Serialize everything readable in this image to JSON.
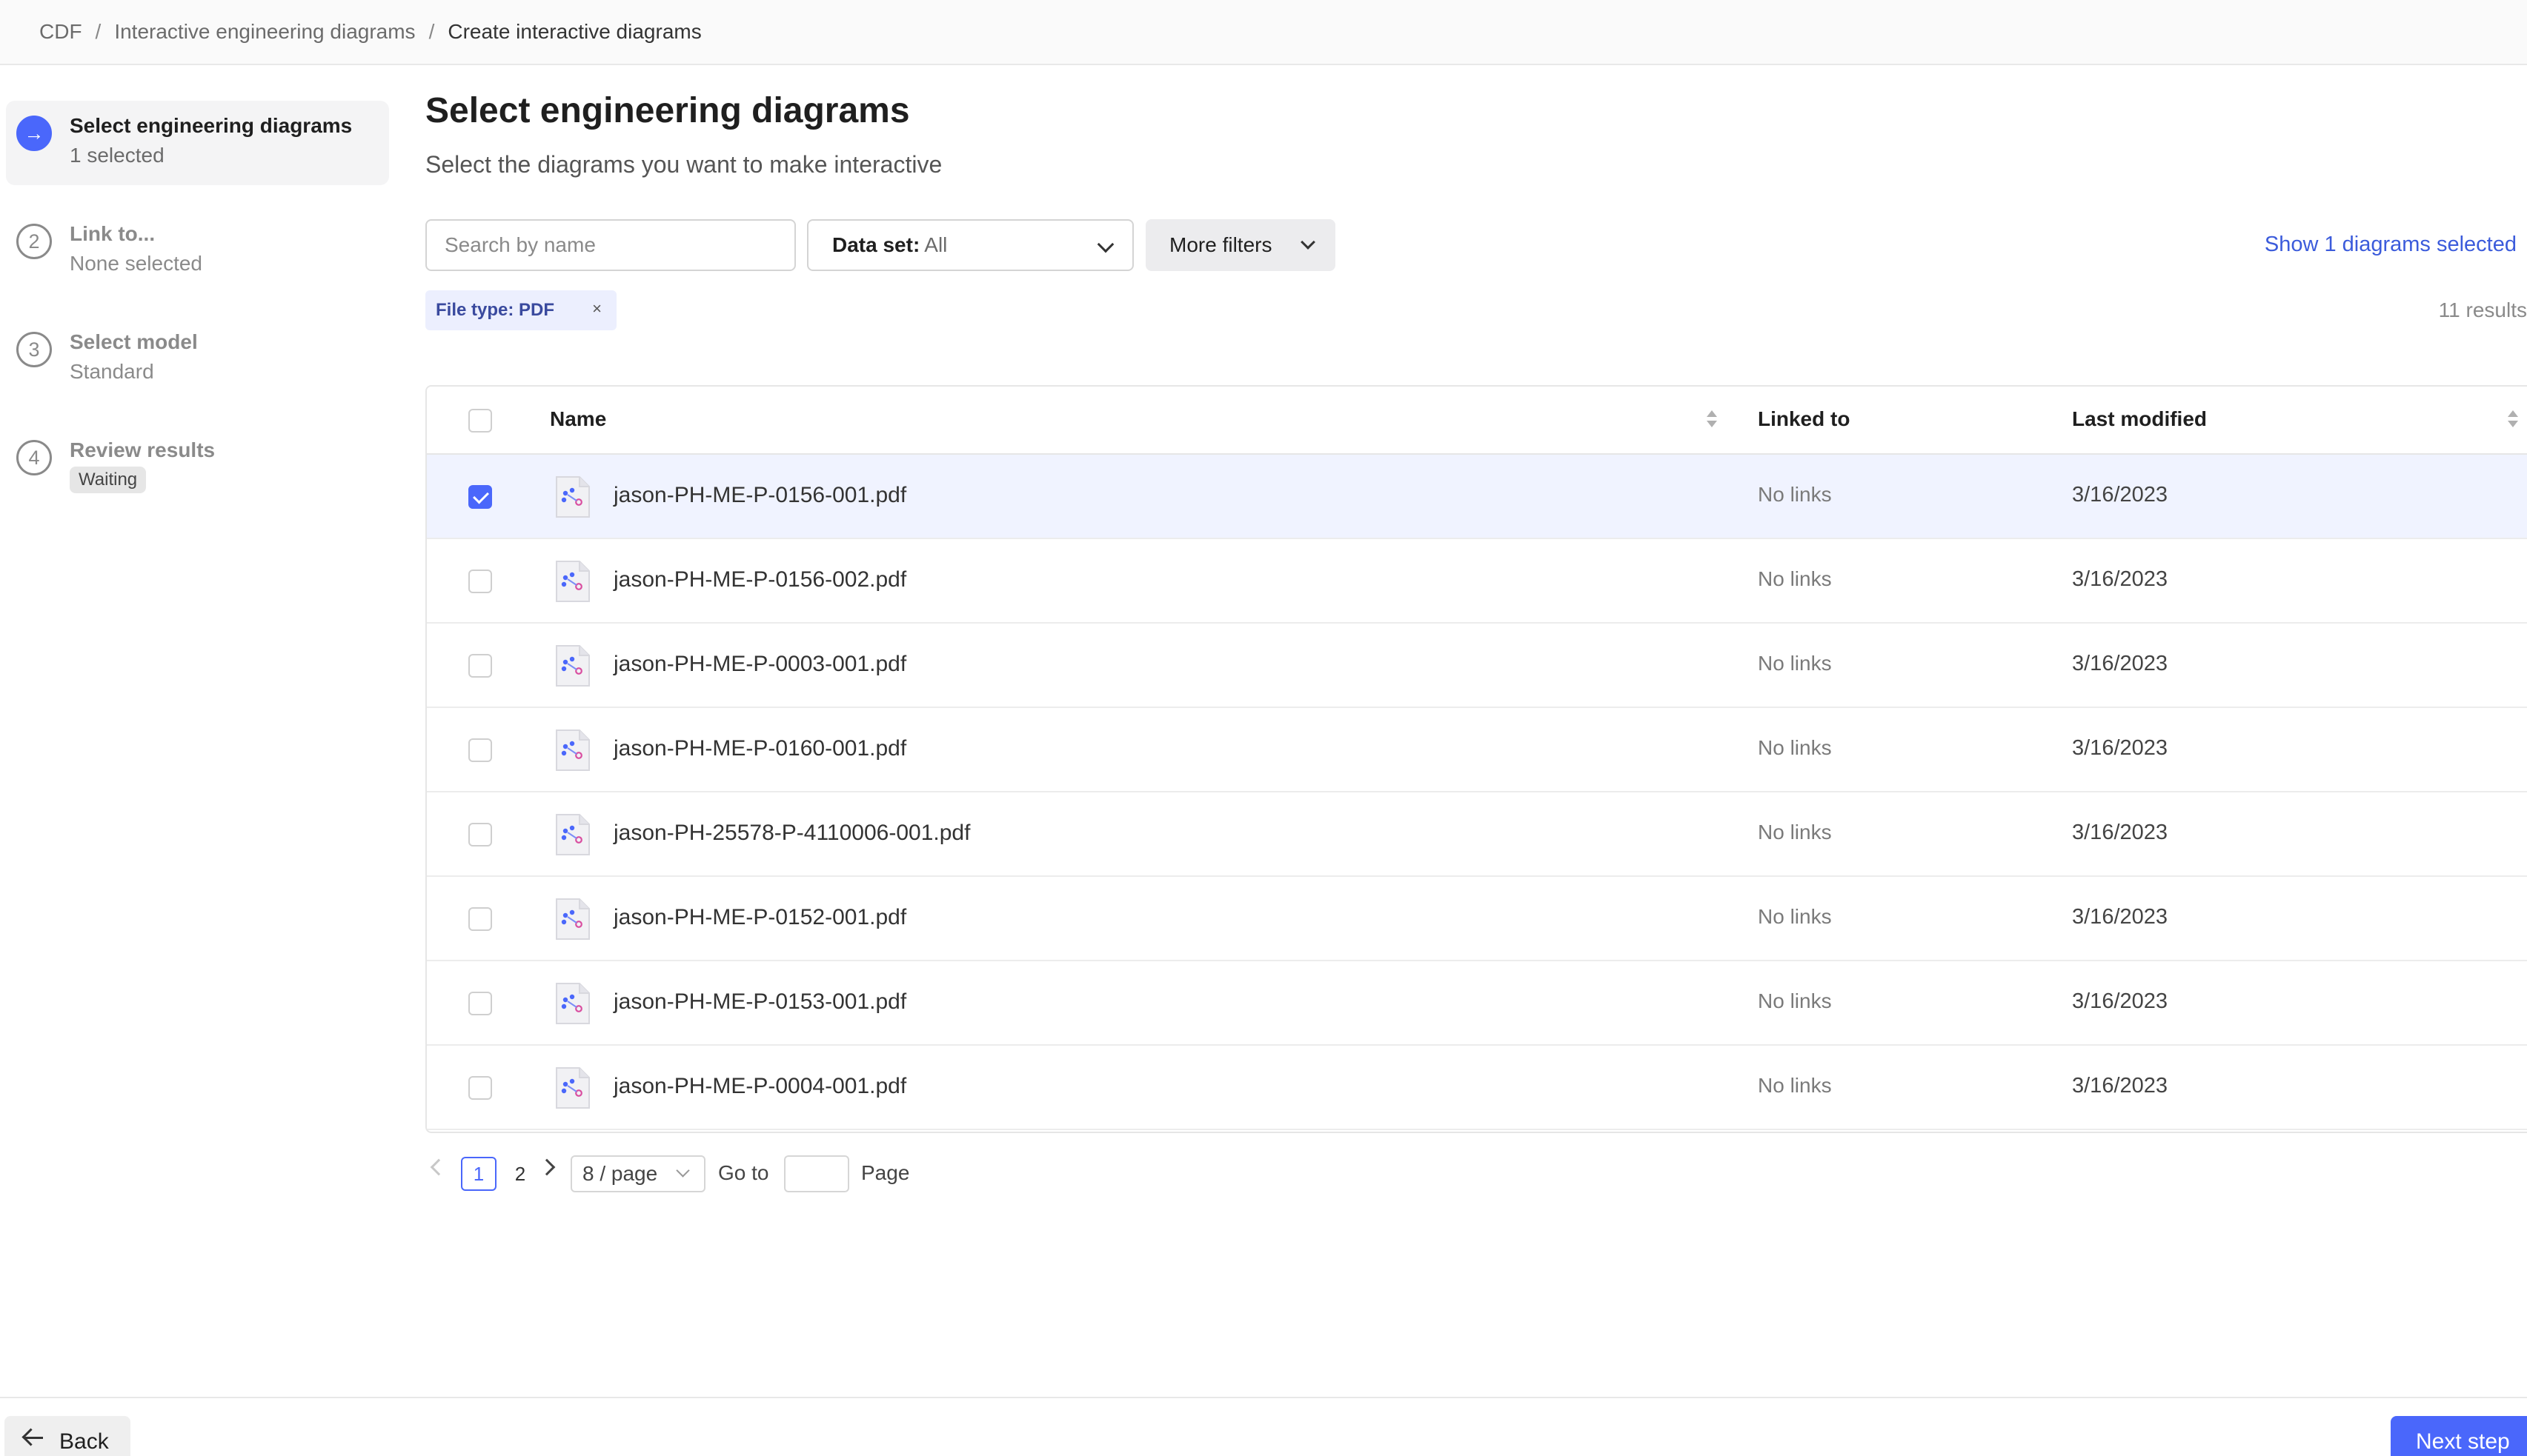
{
  "breadcrumb": {
    "items": [
      "CDF",
      "Interactive engineering diagrams",
      "Create interactive diagrams"
    ],
    "separator": "/"
  },
  "stepper": {
    "steps": [
      {
        "number": "→",
        "title": "Select engineering diagrams",
        "subtitle": "1 selected",
        "active": true
      },
      {
        "number": "2",
        "title": "Link to...",
        "subtitle": "None selected",
        "active": false
      },
      {
        "number": "3",
        "title": "Select model",
        "subtitle": "Standard",
        "active": false
      },
      {
        "number": "4",
        "title": "Review results",
        "badge": "Waiting",
        "active": false
      }
    ]
  },
  "main": {
    "title": "Select engineering diagrams",
    "subtitle": "Select the diagrams you want to make interactive"
  },
  "filters": {
    "search_placeholder": "Search by name",
    "dataset_label": "Data set:",
    "dataset_value": "All",
    "more_filters_label": "More filters",
    "show_selected_label": "Show 1 diagrams selected",
    "chip_label": "File type: PDF",
    "chip_remove": "×",
    "results_count": "11 results"
  },
  "table": {
    "headers": {
      "name": "Name",
      "linked_to": "Linked to",
      "last_modified": "Last modified"
    },
    "rows": [
      {
        "name": "jason-PH-ME-P-0156-001.pdf",
        "linked_to": "No links",
        "last_modified": "3/16/2023",
        "selected": true
      },
      {
        "name": "jason-PH-ME-P-0156-002.pdf",
        "linked_to": "No links",
        "last_modified": "3/16/2023",
        "selected": false
      },
      {
        "name": "jason-PH-ME-P-0003-001.pdf",
        "linked_to": "No links",
        "last_modified": "3/16/2023",
        "selected": false
      },
      {
        "name": "jason-PH-ME-P-0160-001.pdf",
        "linked_to": "No links",
        "last_modified": "3/16/2023",
        "selected": false
      },
      {
        "name": "jason-PH-25578-P-4110006-001.pdf",
        "linked_to": "No links",
        "last_modified": "3/16/2023",
        "selected": false
      },
      {
        "name": "jason-PH-ME-P-0152-001.pdf",
        "linked_to": "No links",
        "last_modified": "3/16/2023",
        "selected": false
      },
      {
        "name": "jason-PH-ME-P-0153-001.pdf",
        "linked_to": "No links",
        "last_modified": "3/16/2023",
        "selected": false
      },
      {
        "name": "jason-PH-ME-P-0004-001.pdf",
        "linked_to": "No links",
        "last_modified": "3/16/2023",
        "selected": false
      }
    ],
    "file_icon": "diagram-file-icon"
  },
  "pagination": {
    "pages": [
      "1",
      "2"
    ],
    "current_page": "1",
    "page_size": "8 / page",
    "goto_label": "Go to",
    "page_label": "Page"
  },
  "footer": {
    "back_label": "Back",
    "next_label": "Next step"
  },
  "colors": {
    "accent": "#4a67fb",
    "link": "#3b5bdb",
    "selected_row": "#f0f3ff"
  }
}
